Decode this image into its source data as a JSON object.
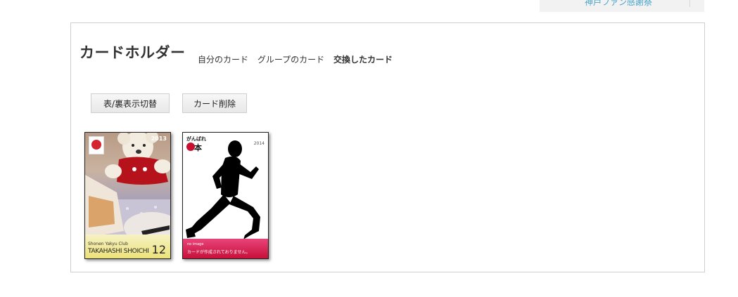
{
  "top_link": {
    "label": "神戸ファン感謝祭"
  },
  "holder": {
    "title": "カードホルダー",
    "tabs": [
      {
        "label": "自分のカード",
        "active": false
      },
      {
        "label": "グループのカード",
        "active": false
      },
      {
        "label": "交換したカード",
        "active": true
      }
    ],
    "buttons": {
      "toggle": "表/裏表示切替",
      "delete": "カード削除"
    }
  },
  "cards": [
    {
      "year": "2013",
      "club": "Shonen Yakyu Club",
      "player": "TAKAHASHI SHOICHI",
      "number": "12",
      "image": "teddy-bear-photo",
      "colors": {
        "footer": "#ece27a",
        "badge": "#d4252f"
      }
    },
    {
      "year": "2014",
      "caption_top": "がんばれ",
      "caption_nippon": "本",
      "no_image": "no image",
      "not_created": "カードが作成されておりません。",
      "image": "runner-silhouette",
      "colors": {
        "footer": "#c8103a",
        "sun": "#c8102e"
      }
    }
  ]
}
